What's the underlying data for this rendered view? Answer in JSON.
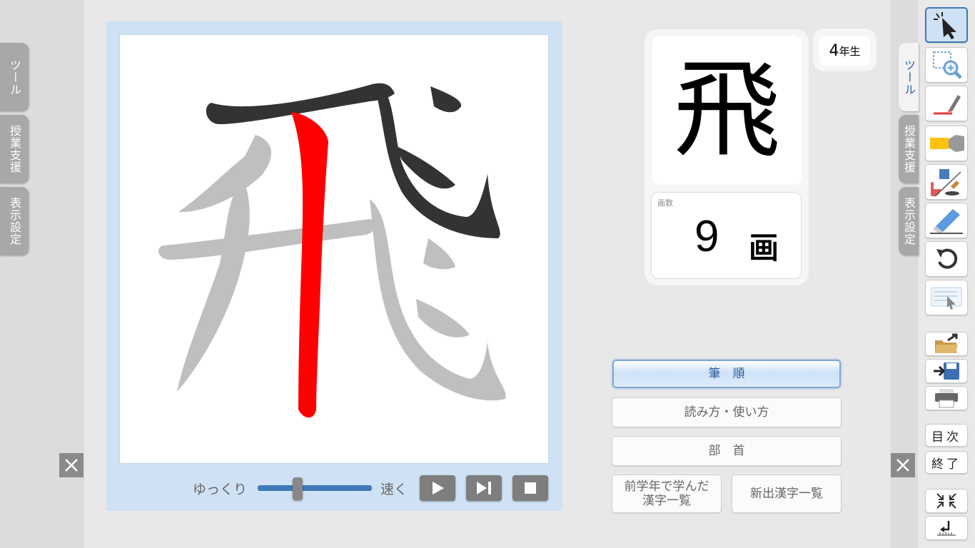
{
  "left_tabs": [
    {
      "label": "ツール"
    },
    {
      "label": "授業支援"
    },
    {
      "label": "表示設定"
    }
  ],
  "right_tabs": [
    {
      "label": "ツール"
    },
    {
      "label": "授業支援"
    },
    {
      "label": "表示設定"
    }
  ],
  "kanji": {
    "character": "飛",
    "grade_number": "4",
    "grade_suffix": "年生",
    "stroke_caption": "画数",
    "stroke_count": "9",
    "stroke_unit": "画"
  },
  "playback": {
    "slow_label": "ゆっくり",
    "fast_label": "速く",
    "speed_level": 0.35
  },
  "menu": {
    "stroke_order": "筆　順",
    "reading_usage": "読み方・使い方",
    "radical": "部　首",
    "prev_year_list": "前学年で学んだ\n漢字一覧",
    "new_kanji_list": "新出漢字一覧"
  },
  "toolbar": {
    "contents_label": "目次",
    "exit_label": "終了"
  },
  "colors": {
    "active_stroke": "#ff0000",
    "done_stroke": "#333333",
    "pending_stroke": "#bfbfbf",
    "accent": "#3f79b7"
  },
  "icons": [
    "select-arrow-icon",
    "zoom-region-icon",
    "pen-icon",
    "highlighter-icon",
    "shape-stamp-icon",
    "eraser-icon",
    "undo-icon",
    "screen-select-icon",
    "open-folder-icon",
    "save-icon",
    "print-icon",
    "shrink-icon",
    "restore-icon"
  ]
}
